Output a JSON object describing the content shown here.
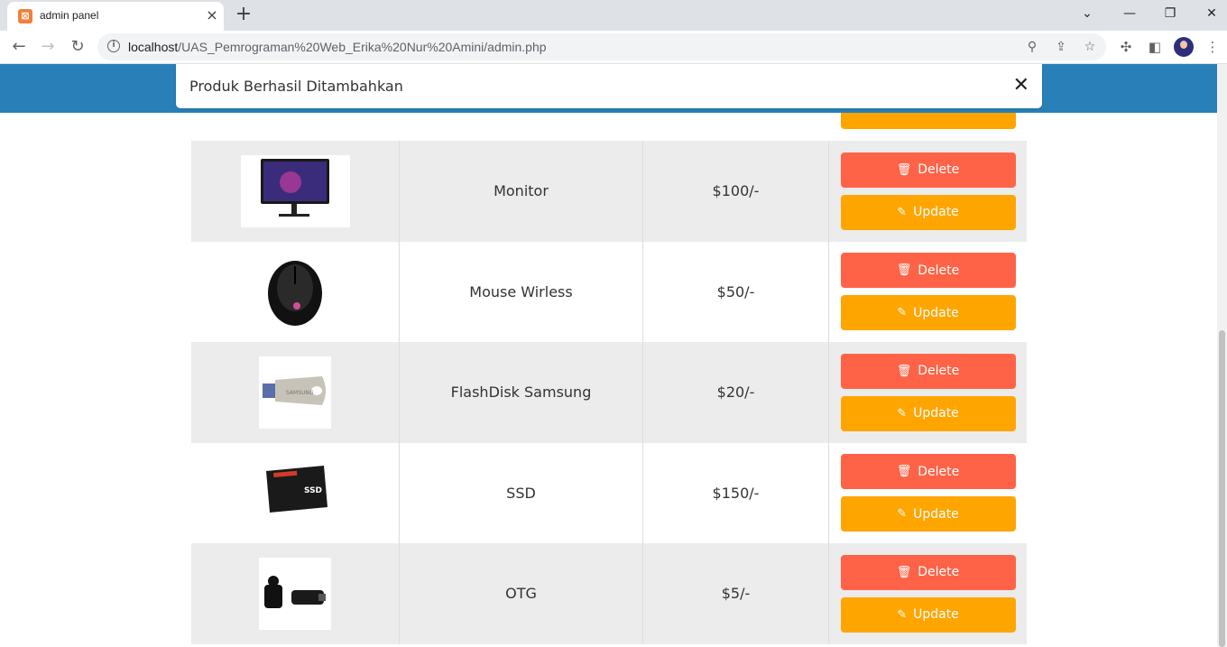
{
  "browser": {
    "tab_title": "admin panel",
    "url_host": "localhost",
    "url_path": "/UAS_Pemrograman%20Web_Erika%20Nur%20Amini/admin.php"
  },
  "message": {
    "text": "Produk Berhasil Ditambahkan",
    "close": "✕"
  },
  "actions": {
    "delete_label": "Delete",
    "update_label": "Update",
    "partial_update_label": "Update"
  },
  "products": [
    {
      "name": "Monitor",
      "price": "$100/-",
      "image": "monitor-image"
    },
    {
      "name": "Mouse Wirless",
      "price": "$50/-",
      "image": "mouse-image"
    },
    {
      "name": "FlashDisk Samsung",
      "price": "$20/-",
      "image": "flashdisk-image"
    },
    {
      "name": "SSD",
      "price": "$150/-",
      "image": "ssd-image"
    },
    {
      "name": "OTG",
      "price": "$5/-",
      "image": "otg-image"
    }
  ],
  "colors": {
    "header": "#2980b9",
    "delete": "#ff6347",
    "update": "#ffa500",
    "row_alt": "#ececec"
  }
}
